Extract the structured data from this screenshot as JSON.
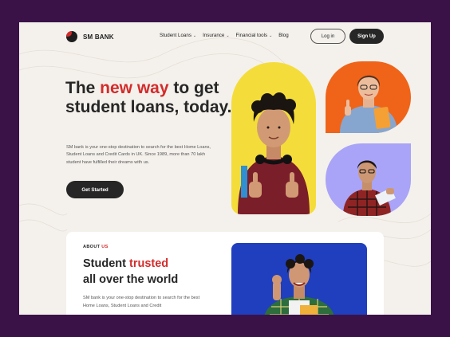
{
  "brand": {
    "name": "SM BANK"
  },
  "nav": {
    "items": [
      {
        "label": "Student Loans",
        "has_dropdown": true
      },
      {
        "label": "Insurance",
        "has_dropdown": true
      },
      {
        "label": "Financial tools",
        "has_dropdown": true
      },
      {
        "label": "Blog",
        "has_dropdown": false
      }
    ],
    "login_label": "Log in",
    "signup_label": "Sign Up"
  },
  "hero": {
    "title_part1": "The ",
    "title_highlight": "new way",
    "title_part2": " to get student loans, today.",
    "description": "SM bank is your one-stop destination to search for the best Home Loans, Student Loans and Credit Cards in UK. Since 1989, more than 70 lakh student have fulfilled their dreams with us.",
    "cta_label": "Get Started"
  },
  "about": {
    "label_part1": "ABOUT ",
    "label_highlight": "US",
    "title_part1": "Student ",
    "title_highlight": "trusted",
    "title_part2": "all over the world",
    "description": "SM bank is your one-stop destination to search for the best Home Loans, Student Loans and Credit"
  },
  "colors": {
    "accent": "#d42b2b",
    "dark": "#262626",
    "background": "#f4f1ec",
    "outer": "#3b1248",
    "yellow_card": "#f4dd3a",
    "orange_card": "#ef6419",
    "purple_card": "#a9a4f7",
    "blue_card": "#1f3fbf"
  },
  "icons": [
    "logo-icon",
    "chevron-down-icon"
  ]
}
